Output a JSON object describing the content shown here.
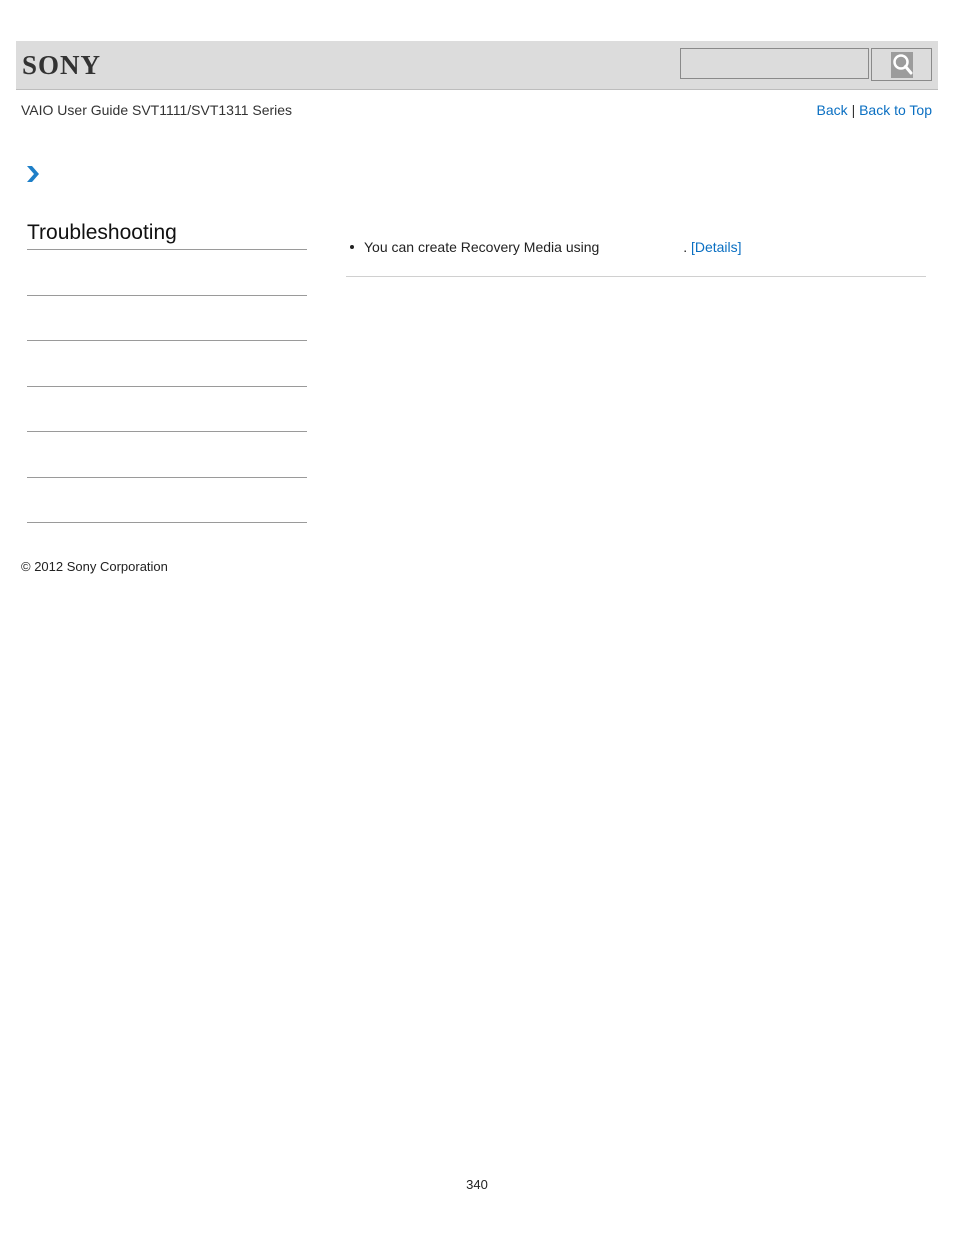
{
  "header": {
    "logo_text": "SONY",
    "search": {
      "placeholder": "",
      "value": ""
    },
    "search_icon": "magnifier-icon"
  },
  "guide_title": "VAIO User Guide SVT1111/SVT1311 Series",
  "nav": {
    "back_label": "Back",
    "separator": "|",
    "back_to_top_label": "Back to Top"
  },
  "breadcrumb_icon": "chevron-right-icon",
  "sidebar": {
    "title": "Troubleshooting",
    "items": [
      "",
      "",
      "",
      "",
      "",
      ""
    ]
  },
  "content": {
    "items": [
      {
        "text_before": "You can create Recovery Media using",
        "text_after": ".",
        "link_label": "[Details]"
      }
    ]
  },
  "footer": {
    "copyright": "© 2012 Sony Corporation",
    "page_number": "340"
  },
  "colors": {
    "link": "#0a6fc2",
    "header_bg": "#dcdcdc",
    "chevron": "#1e7fc8"
  }
}
